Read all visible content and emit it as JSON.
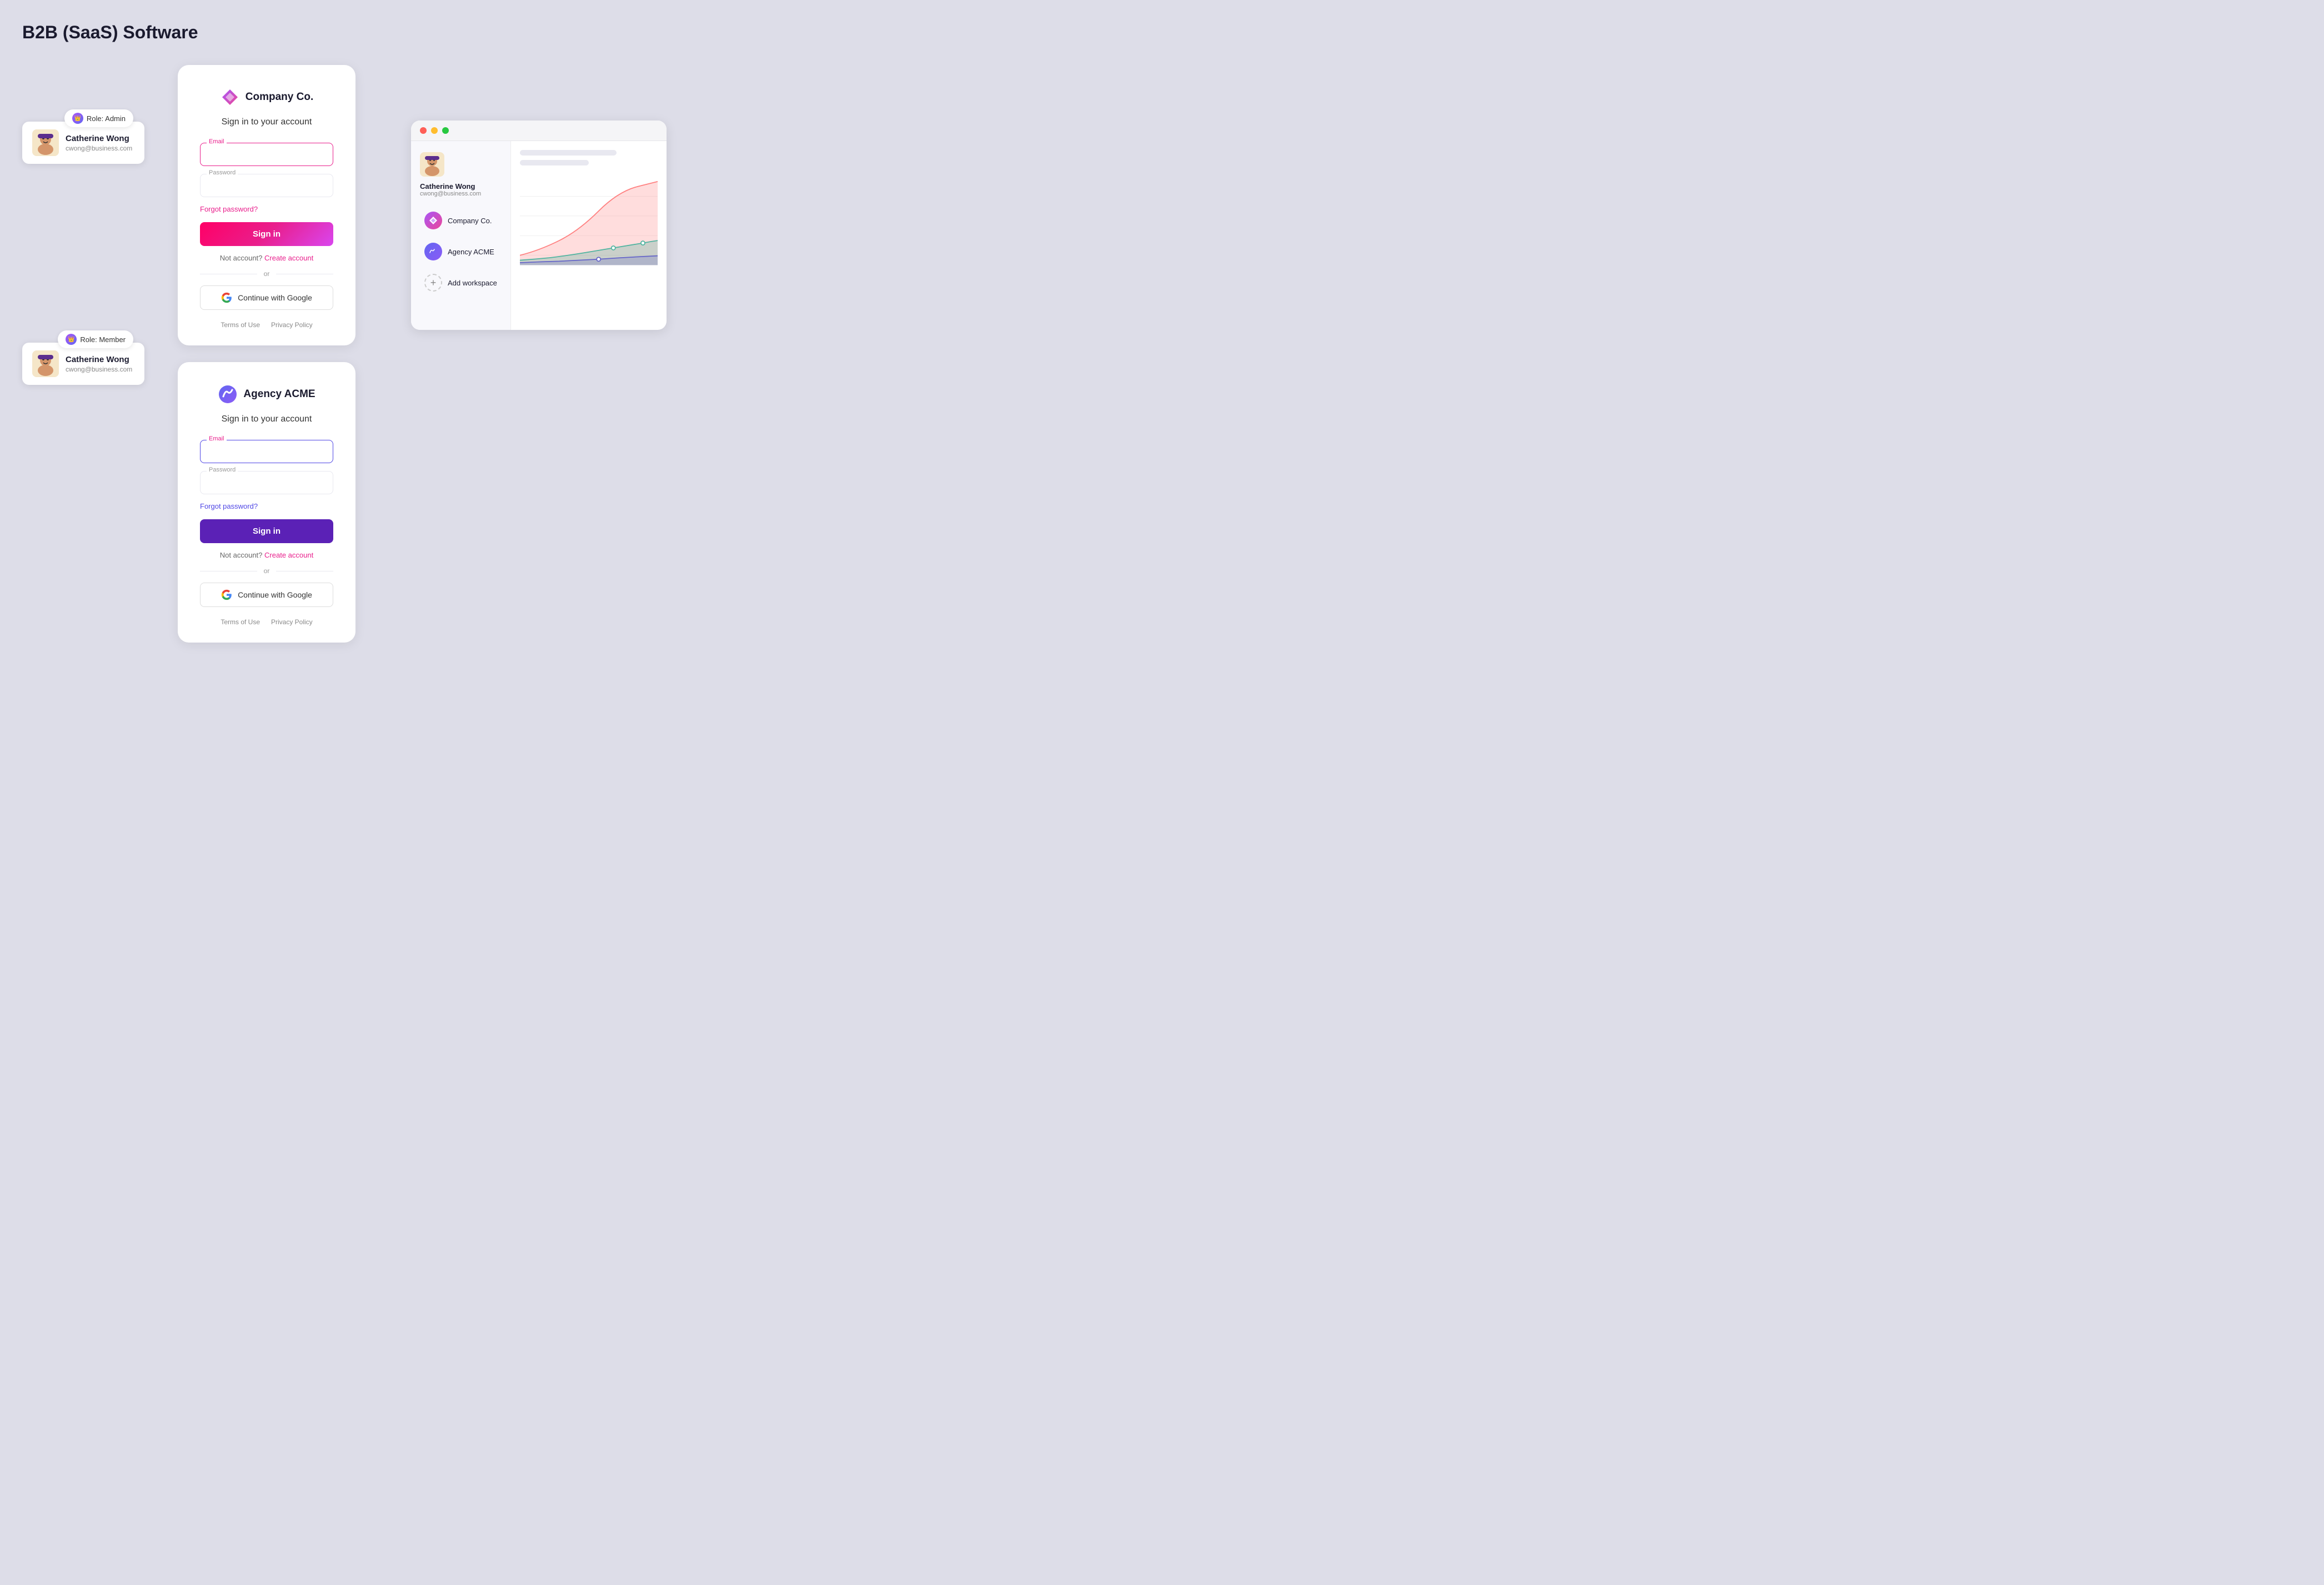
{
  "page": {
    "title": "B2B (SaaS) Software",
    "background": "#dddde8"
  },
  "user1": {
    "name": "Catherine Wong",
    "email": "cwong@business.com",
    "role": "Role: Admin"
  },
  "user2": {
    "name": "Catherine Wong",
    "email": "cwong@business.com",
    "role": "Role: Member"
  },
  "login_card_1": {
    "logo_name": "Company Co.",
    "sign_in_label": "Sign in to your account",
    "email_label": "Email",
    "email_placeholder": "",
    "password_placeholder": "Password",
    "forgot_label": "Forgot password?",
    "sign_in_btn": "Sign in",
    "no_account_text": "Not account?",
    "create_account": "Create account",
    "or_text": "or",
    "google_btn": "Continue with Google",
    "footer_terms": "Terms of Use",
    "footer_privacy": "Privacy Policy"
  },
  "login_card_2": {
    "logo_name": "Agency ACME",
    "sign_in_label": "Sign in to your account",
    "email_label": "Email",
    "email_placeholder": "",
    "password_placeholder": "Password",
    "forgot_label": "Forgot password?",
    "sign_in_btn": "Sign in",
    "no_account_text": "Not account?",
    "create_account": "Create account",
    "or_text": "or",
    "google_btn": "Continue with Google",
    "footer_terms": "Terms of Use",
    "footer_privacy": "Privacy Policy"
  },
  "workspace_panel": {
    "user_name": "Catherine Wong",
    "user_email": "cwong@business.com",
    "workspaces": [
      {
        "name": "Company Co.",
        "color": "#8b5cf6"
      },
      {
        "name": "Agency ACME",
        "color": "#6366f1"
      }
    ],
    "add_workspace": "Add workspace"
  }
}
